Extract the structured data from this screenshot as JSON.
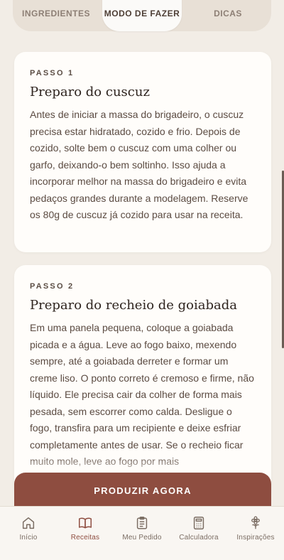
{
  "tabs": [
    {
      "label": "INGREDIENTES"
    },
    {
      "label": "MODO DE FAZER"
    },
    {
      "label": "DICAS"
    }
  ],
  "steps": [
    {
      "label": "PASSO 1",
      "title": "Preparo do cuscuz",
      "text": "Antes de iniciar a massa do brigadeiro, o cuscuz precisa estar hidratado, cozido e frio. Depois de cozido, solte bem o cuscuz com uma colher ou garfo, deixando-o bem soltinho. Isso ajuda a incorporar melhor na massa do brigadeiro e evita pedaços grandes durante a modelagem. Reserve os 80g de cuscuz já cozido para usar na receita."
    },
    {
      "label": "PASSO 2",
      "title": "Preparo do recheio de goiabada",
      "text": "Em uma panela pequena, coloque a goiabada picada e a água. Leve ao fogo baixo, mexendo sempre, até a goiabada derreter e formar um creme liso. O ponto correto é cremoso e firme, não líquido. Ele precisa cair da colher de forma mais pesada, sem escorrer como calda. Desligue o fogo, transfira para um recipiente e deixe esfriar completamente antes de usar. Se o recheio ficar muito mole, leve ao fogo por mais"
    }
  ],
  "cta": {
    "label": "PRODUZIR AGORA"
  },
  "nav": [
    {
      "label": "Início",
      "icon": "home-icon"
    },
    {
      "label": "Receitas",
      "icon": "book-icon"
    },
    {
      "label": "Meu Pedido",
      "icon": "clipboard-icon"
    },
    {
      "label": "Calculadora",
      "icon": "calculator-icon"
    },
    {
      "label": "Inspirações",
      "icon": "flower-icon"
    }
  ],
  "colors": {
    "accent": "#8e4d40",
    "background": "#f2ede6",
    "card": "#fffdfa"
  }
}
